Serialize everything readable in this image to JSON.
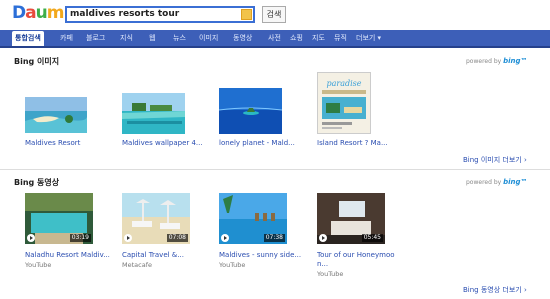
{
  "header": {
    "logo_letters": [
      "D",
      "a",
      "u",
      "m"
    ],
    "logo_colors": [
      "#2c6fd8",
      "#e94b3c",
      "#3fae49",
      "#f2a81d"
    ],
    "search_value": "maldives resorts tour",
    "search_button": "검색"
  },
  "nav": {
    "tabs": [
      {
        "label": "통합검색",
        "active": true
      },
      {
        "label": "카페"
      },
      {
        "label": "블로그"
      },
      {
        "label": "지식"
      },
      {
        "label": "웹"
      },
      {
        "label": "뉴스"
      },
      {
        "label": "이미지"
      },
      {
        "label": "동영상"
      },
      {
        "label": "사전"
      },
      {
        "label": "쇼핑"
      },
      {
        "label": "지도"
      },
      {
        "label": "뮤직"
      },
      {
        "label": "더보기 ▾"
      }
    ]
  },
  "images_section": {
    "title": "Bing 이미지",
    "powered": "powered by",
    "powered_brand": "bing™",
    "items": [
      {
        "caption": "Maldives Resort"
      },
      {
        "caption": "Maldives wallpaper 4..."
      },
      {
        "caption": "lonely planet - Mald..."
      },
      {
        "caption": "Island Resort ? Ma..."
      }
    ],
    "more": "Bing 이미지 더보기 ›",
    "magazine_title": "paradise"
  },
  "video_section": {
    "title": "Bing 동영상",
    "powered": "powered by",
    "powered_brand": "bing™",
    "items": [
      {
        "caption": "Naladhu Resort Maldiv...",
        "source": "YouTube",
        "duration": "03:19"
      },
      {
        "caption": "Capital Travel &...",
        "source": "Metacafe",
        "duration": "07:08"
      },
      {
        "caption": "Maldives - sunny side...",
        "source": "YouTube",
        "duration": "07:38"
      },
      {
        "caption": "Tour of our Honeymoo",
        "caption2": "n...",
        "source": "YouTube",
        "duration": "05:45"
      }
    ],
    "more": "Bing 동영상 더보기 ›"
  }
}
